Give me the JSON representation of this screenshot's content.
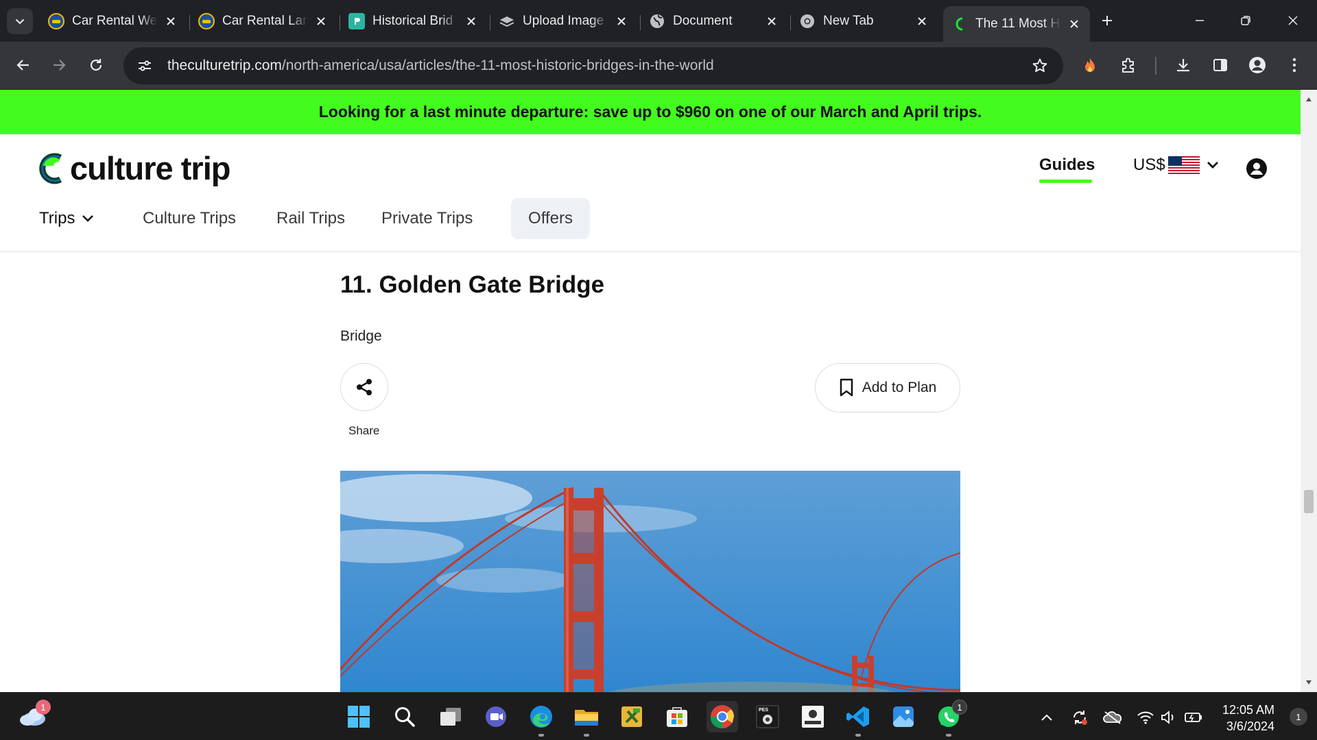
{
  "browser": {
    "tabs": [
      {
        "title": "Car Rental We",
        "icon": "car-rental-favicon",
        "active": false
      },
      {
        "title": "Car Rental Lan",
        "icon": "car-rental-favicon",
        "active": false
      },
      {
        "title": "Historical Brid",
        "icon": "document-favicon",
        "active": false
      },
      {
        "title": "Upload Image",
        "icon": "layers-favicon",
        "active": false
      },
      {
        "title": "Document",
        "icon": "globe-favicon",
        "active": false
      },
      {
        "title": "New Tab",
        "icon": "chrome-favicon",
        "active": false
      },
      {
        "title": "The 11 Most H",
        "icon": "culture-trip-favicon",
        "active": true
      }
    ],
    "url_domain": "theculturetrip.com",
    "url_path": "/north-america/usa/articles/the-11-most-historic-bridges-in-the-world"
  },
  "promo": {
    "text": "Looking for a last minute departure: save up to $960 on one of our March and April trips."
  },
  "header": {
    "logo_text": "culture trip",
    "guides_label": "Guides",
    "currency_label": "US$",
    "nav": [
      {
        "label": "Trips"
      },
      {
        "label": "Culture Trips"
      },
      {
        "label": "Rail Trips"
      },
      {
        "label": "Private Trips"
      },
      {
        "label": "Offers"
      }
    ]
  },
  "article": {
    "heading": "11. Golden Gate Bridge",
    "type_label": "Bridge",
    "share_label": "Share",
    "add_to_plan_label": "Add to Plan",
    "image_subject": "Golden Gate Bridge tower against blue sky"
  },
  "taskbar": {
    "weather_badge": "1",
    "whatsapp_badge": "1",
    "time": "12:05 AM",
    "date": "3/6/2024",
    "notification_count": "1"
  },
  "colors": {
    "promo_bg": "#43fb1e",
    "accent_green": "#43fb1e",
    "offers_bg": "#edf1f6",
    "chrome_dark": "#202124",
    "chrome_toolbar": "#35363a"
  }
}
